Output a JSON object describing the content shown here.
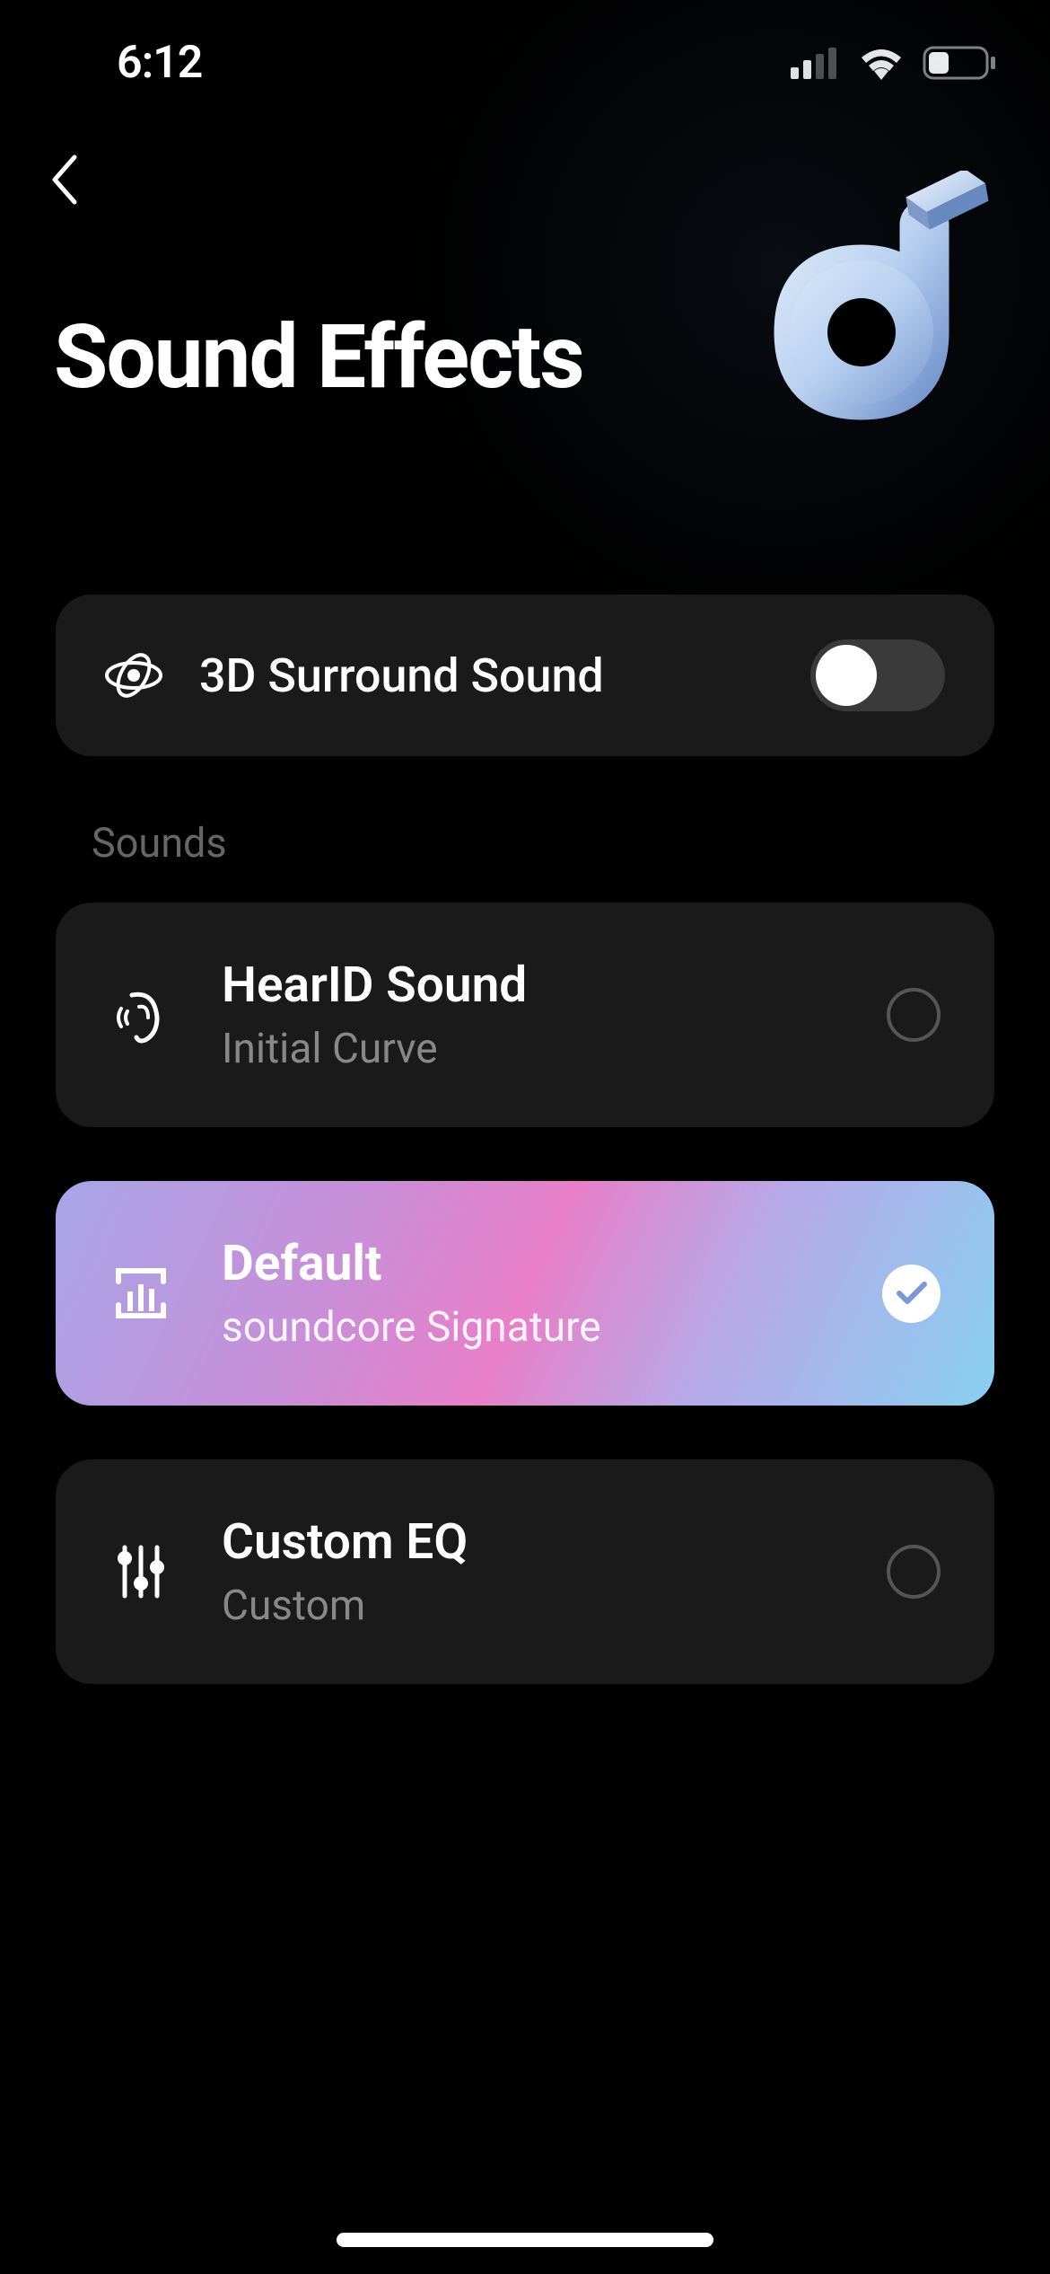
{
  "statusBar": {
    "time": "6:12"
  },
  "header": {
    "title": "Sound Effects"
  },
  "surroundSound": {
    "label": "3D Surround Sound",
    "enabled": false
  },
  "sections": {
    "sounds": {
      "header": "Sounds",
      "items": [
        {
          "title": "HearID Sound",
          "subtitle": "Initial Curve",
          "selected": false,
          "iconName": "ear-icon"
        },
        {
          "title": "Default",
          "subtitle": "soundcore Signature",
          "selected": true,
          "iconName": "equalizer-preset-icon"
        },
        {
          "title": "Custom EQ",
          "subtitle": "Custom",
          "selected": false,
          "iconName": "sliders-icon"
        }
      ]
    }
  }
}
